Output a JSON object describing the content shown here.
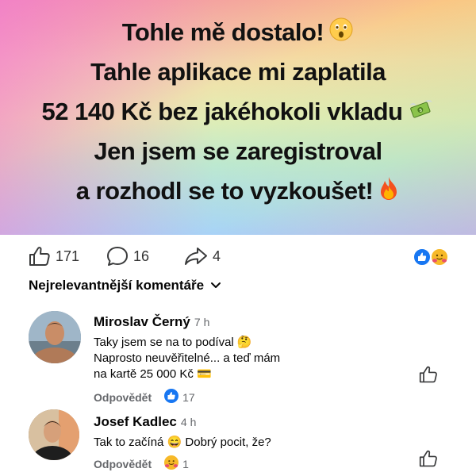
{
  "post": {
    "lines": [
      "Tohle mě dostalo!",
      "Tahle aplikace mi zaplatila",
      "52 140 Kč bez jakéhokoli vkladu",
      "Jen jsem se zaregistroval",
      "a rozhodl se to vyzkoušet!"
    ],
    "line_emojis": [
      "astonished-face-emoji",
      "",
      "money-with-wings-emoji",
      "",
      "fire-emoji"
    ]
  },
  "stats": {
    "likes": "171",
    "comments": "16",
    "shares": "4"
  },
  "reactions": [
    "like-reaction",
    "hug-reaction"
  ],
  "sort_label": "Nejrelevantnější komentáře",
  "comments": [
    {
      "name": "Miroslav Černý",
      "time": "7 h",
      "lines": [
        "Taky jsem se na to podíval 🤔",
        "Naprosto neuvěřitelné... a teď mám",
        "na kartě 25 000 Kč 💳"
      ],
      "reply_label": "Odpovědět",
      "reaction_count": "17",
      "reaction": "like-reaction"
    },
    {
      "name": "Josef Kadlec",
      "time": "4 h",
      "lines": [
        "Tak to začíná 😄 Dobrý pocit, že?"
      ],
      "reply_label": "Odpovědět",
      "reaction_count": "1",
      "reaction": "hug-reaction"
    }
  ],
  "colors": {
    "like_blue": "#1877f2",
    "hug_yellow": "#f7b928",
    "secondary_text": "#65676b"
  }
}
